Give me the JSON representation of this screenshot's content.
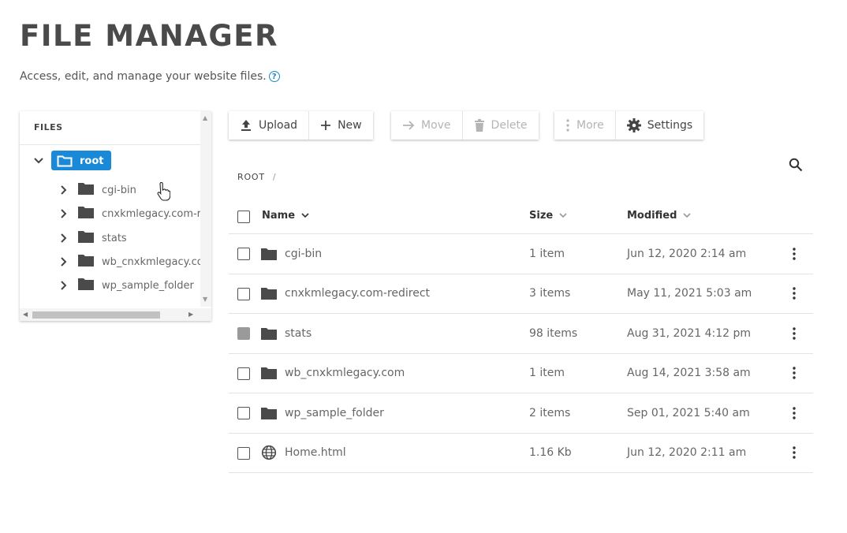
{
  "header": {
    "title": "FILE MANAGER",
    "subtitle": "Access, edit, and manage your website files.",
    "help_icon": "question-circle-icon"
  },
  "tree": {
    "header": "FILES",
    "root_label": "root",
    "items": [
      {
        "label": "cgi-bin"
      },
      {
        "label": "cnxkmlegacy.com-re"
      },
      {
        "label": "stats"
      },
      {
        "label": "wb_cnxkmlegacy.co"
      },
      {
        "label": "wp_sample_folder"
      }
    ]
  },
  "toolbar": {
    "upload": "Upload",
    "new": "New",
    "move": "Move",
    "delete": "Delete",
    "more": "More",
    "settings": "Settings"
  },
  "breadcrumb": {
    "root": "ROOT",
    "separator": "/"
  },
  "table": {
    "columns": {
      "name": "Name",
      "size": "Size",
      "modified": "Modified"
    },
    "rows": [
      {
        "name": "cgi-bin",
        "size": "1 item",
        "modified": "Jun 12, 2020 2:14 am",
        "icon": "folder-icon"
      },
      {
        "name": "cnxkmlegacy.com-redirect",
        "size": "3 items",
        "modified": "May 11, 2021 5:03 am",
        "icon": "folder-icon"
      },
      {
        "name": "stats",
        "size": "98 items",
        "modified": "Aug 31, 2021 4:12 pm",
        "icon": "folder-icon"
      },
      {
        "name": "wb_cnxkmlegacy.com",
        "size": "1 item",
        "modified": "Aug 14, 2021 3:58 am",
        "icon": "folder-icon"
      },
      {
        "name": "wp_sample_folder",
        "size": "2 items",
        "modified": "Sep 01, 2021 5:40 am",
        "icon": "folder-icon"
      },
      {
        "name": "Home.html",
        "size": "1.16 Kb",
        "modified": "Jun 12, 2020 2:11 am",
        "icon": "globe-icon"
      }
    ]
  },
  "colors": {
    "accent": "#1a8ad8",
    "text": "#4a4a4a",
    "disabled": "#b4b4b4"
  }
}
